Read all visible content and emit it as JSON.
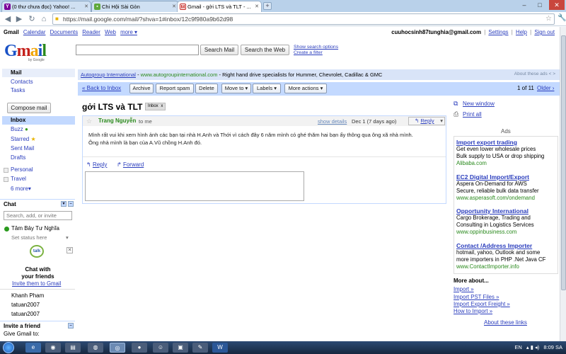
{
  "browser": {
    "tabs": [
      {
        "label": "(0 thư chưa đọc) Yahoo! ...",
        "icon": "yahoo-icon"
      },
      {
        "label": "Chi Hội Sài Gòn",
        "icon": "chat-bubble-icon"
      },
      {
        "label": "Gmail - gởi LTS và TLT - ...",
        "icon": "gmail-icon"
      }
    ],
    "url": "https://mail.google.com/mail/?shva=1#inbox/12c9f980a9b62d98"
  },
  "gbar": {
    "links": [
      "Gmail",
      "Calendar",
      "Documents",
      "Reader",
      "Web",
      "more ▾"
    ],
    "email": "cuuhocsinh87tunghia@gmail.com",
    "settings": "Settings",
    "help": "Help",
    "signout": "Sign out"
  },
  "header": {
    "logo_g": "G",
    "logo_m": "m",
    "logo_a": "a",
    "logo_i": "i",
    "logo_l": "l",
    "by_google": "by Google",
    "search_mail": "Search Mail",
    "search_web": "Search the Web",
    "show_options": "Show search options",
    "create_filter": "Create a filter"
  },
  "sidebar": {
    "mail": "Mail",
    "contacts": "Contacts",
    "tasks": "Tasks",
    "compose": "Compose mail",
    "inbox": "Inbox",
    "buzz": "Buzz",
    "starred": "Starred",
    "sent": "Sent Mail",
    "drafts": "Drafts",
    "personal": "Personal",
    "travel": "Travel",
    "more": "6 more▾",
    "chat": "Chat",
    "chat_search_placeholder": "Search, add, or invite",
    "me_name": "Tâm Bảy Tư Nghĩa",
    "set_status": "Set status here",
    "talk_badge": "talk",
    "chat_with": "Chat with",
    "your_friends": "your friends",
    "invite_gmail": "Invite them to Gmail",
    "contacts_list": [
      "Khanh Pham",
      "tatuan2007",
      "tatuan2007"
    ],
    "invite_friend": "Invite a friend",
    "give_gmail": "Give Gmail to:"
  },
  "adbar": {
    "name": "Autogroup International",
    "dash": " - ",
    "url": "www.autogroupinternational.com",
    "text": " - Right hand drive specialists for Hummer, Chevrolet, Cadillac & GMC",
    "about": "About these ads"
  },
  "actions": {
    "back": "« Back to Inbox",
    "archive": "Archive",
    "spam": "Report spam",
    "delete": "Delete",
    "move": "Move to ▾",
    "labels": "Labels ▾",
    "more": "More actions ▾",
    "count": "1 of 11",
    "older": "Older ›"
  },
  "message": {
    "subject": "gởi LTS và TLT",
    "label": "Inbox",
    "label_close": "x",
    "sender": "Trang Nguyễn",
    "to": "to me",
    "show_details": "show details",
    "date": "Dec 1 (7 days ago)",
    "reply_btn": "Reply",
    "body": "Mình rất vui khi xem hình ảnh các bạn tại nhà  H.Anh và Thới vì cách đây 6 năm mình có ghé thăm hai bạn ấy thông qua ông xã nhà mình. Ông nhà mình là bạn của A.Vũ chồng H.Anh đó.",
    "reply_link": "Reply",
    "forward_link": "Forward"
  },
  "right": {
    "new_window": "New window",
    "print_all": "Print all",
    "ads_title": "Ads",
    "ads": [
      {
        "title": "Import export trading",
        "line1": "Get even lower wholesale prices",
        "line2": "Bulk supply to USA or drop shipping",
        "url": "Alibaba.com"
      },
      {
        "title": "EC2 Digital Import/Export",
        "line1": "Aspera On-Demand for AWS",
        "line2": "Secure, reliable bulk data transfer",
        "url": "www.asperasoft.com/ondemand"
      },
      {
        "title": "Opportunity International",
        "line1": "Cargo Brokerage, Trading and",
        "line2": "Consulting in Logistics Services",
        "url": "www.oppinbusiness.com"
      },
      {
        "title": "Contact /Address Importer",
        "line1": "hotmail, yahoo, Outlook and some",
        "line2": "more importers in PHP .Net Java CF",
        "url": "www.ContactImporter.info"
      }
    ],
    "more_about": "More about...",
    "more_links": [
      "Import »",
      "Import PST Files »",
      "Import Export Freight »",
      "How to Import »"
    ],
    "about_links": "About these links"
  },
  "taskbar": {
    "lang": "EN",
    "time": "8:09 SA"
  },
  "colors": {
    "accent": "#c3d9ff",
    "link": "#2a3dbd",
    "url_green": "#2a8a1d"
  }
}
